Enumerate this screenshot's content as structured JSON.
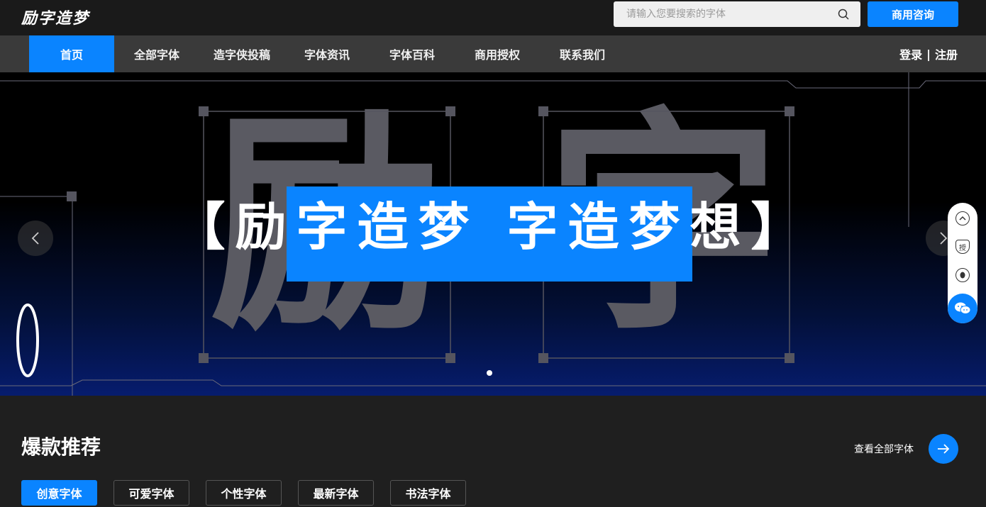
{
  "header": {
    "logo": "励字造梦",
    "search_placeholder": "请输入您要搜索的字体",
    "consult_label": "商用咨询"
  },
  "nav": {
    "items": [
      {
        "label": "首页",
        "active": true
      },
      {
        "label": "全部字体"
      },
      {
        "label": "造字侠投稿"
      },
      {
        "label": "字体资讯"
      },
      {
        "label": "字体百科"
      },
      {
        "label": "商用授权"
      },
      {
        "label": "联系我们"
      }
    ],
    "login": "登录",
    "separator": "|",
    "register": "注册"
  },
  "banner": {
    "bg_chars": [
      "励",
      "字"
    ],
    "slogan": "【励字造梦 字造梦想】",
    "accent_color": "#0a84ff"
  },
  "sidebar": {
    "icons": [
      "chevron-up-icon",
      "authorize-icon",
      "qq-icon",
      "wechat-icon"
    ],
    "authorize_glyph": "授"
  },
  "recommend": {
    "title": "爆款推荐",
    "view_all": "查看全部字体",
    "tabs": [
      {
        "label": "创意字体",
        "active": true
      },
      {
        "label": "可爱字体"
      },
      {
        "label": "个性字体"
      },
      {
        "label": "最新字体"
      },
      {
        "label": "书法字体"
      }
    ]
  },
  "colors": {
    "accent": "#0a84ff",
    "topbar": "#1a1a1a",
    "nav": "#3a3a3a",
    "page_bg": "#1f1f1f"
  }
}
